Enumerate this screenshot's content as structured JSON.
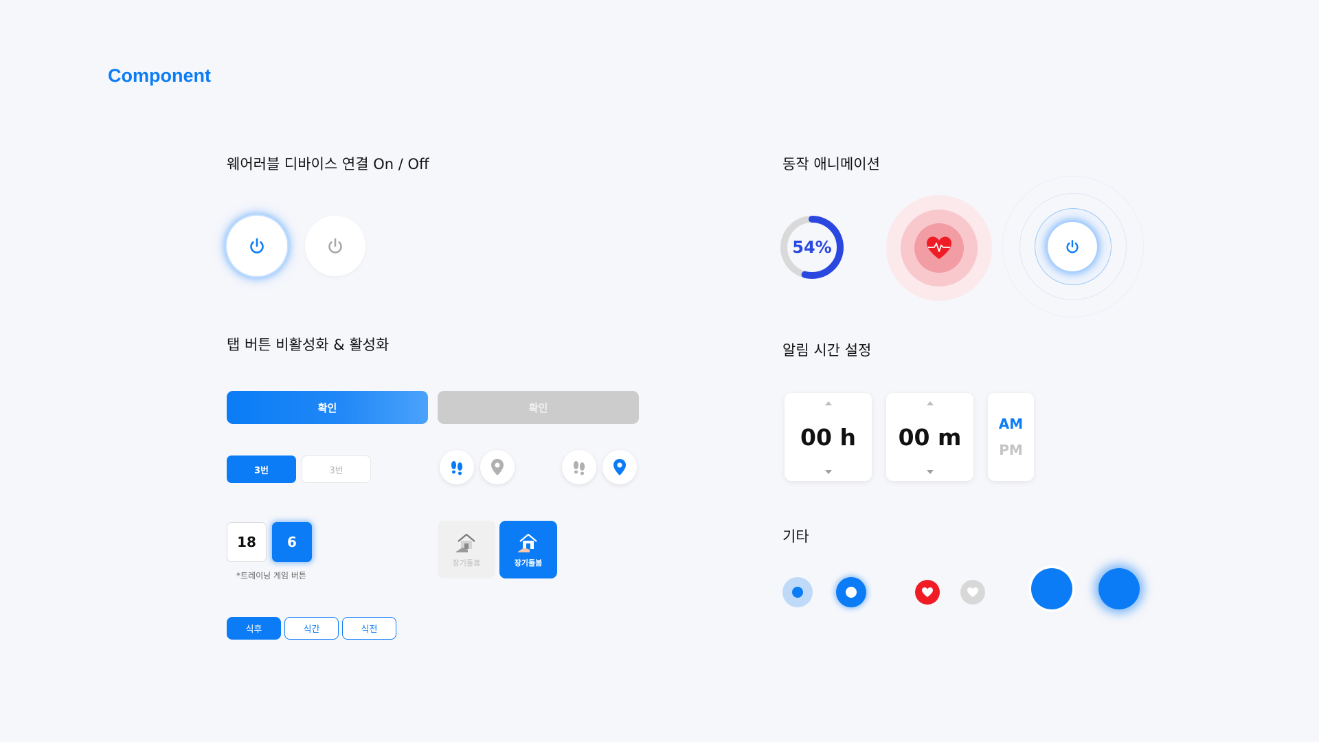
{
  "page": {
    "title": "Component"
  },
  "colors": {
    "accent": "#0b7cf5",
    "heart": "#ef1c25",
    "progress": "#2a48e0"
  },
  "sections": {
    "wearable": "웨어러블 디바이스 연결 On / Off",
    "tabs": "탭 버튼 비활성화 & 활성화",
    "animation": "동작 애니메이션",
    "alarm": "알림 시간 설정",
    "etc": "기타"
  },
  "wearable": {
    "on_icon": "power-icon",
    "off_icon": "power-icon"
  },
  "tabs": {
    "confirm_active": "확인",
    "confirm_inactive": "확인",
    "num_active": "3번",
    "num_inactive": "3번",
    "icons": [
      "footprints-icon",
      "location-pin-icon",
      "footprints-icon",
      "location-pin-icon"
    ],
    "game_numbers": [
      "18",
      "6"
    ],
    "game_note": "*트레이닝 게임 버튼",
    "care_inactive": "장기돌봄",
    "care_active": "장기돌봄",
    "meals": [
      "식후",
      "식간",
      "식전"
    ]
  },
  "animation": {
    "progress_label": "54%",
    "progress": 0.54,
    "heart_icon": "heartbeat-icon",
    "power_icon": "power-icon"
  },
  "alarm": {
    "hours": "00 h",
    "minutes": "00 m",
    "am": "AM",
    "pm": "PM"
  },
  "etc": {
    "icons": [
      "radio-icon",
      "radio-icon",
      "heart-icon",
      "heart-icon"
    ]
  }
}
